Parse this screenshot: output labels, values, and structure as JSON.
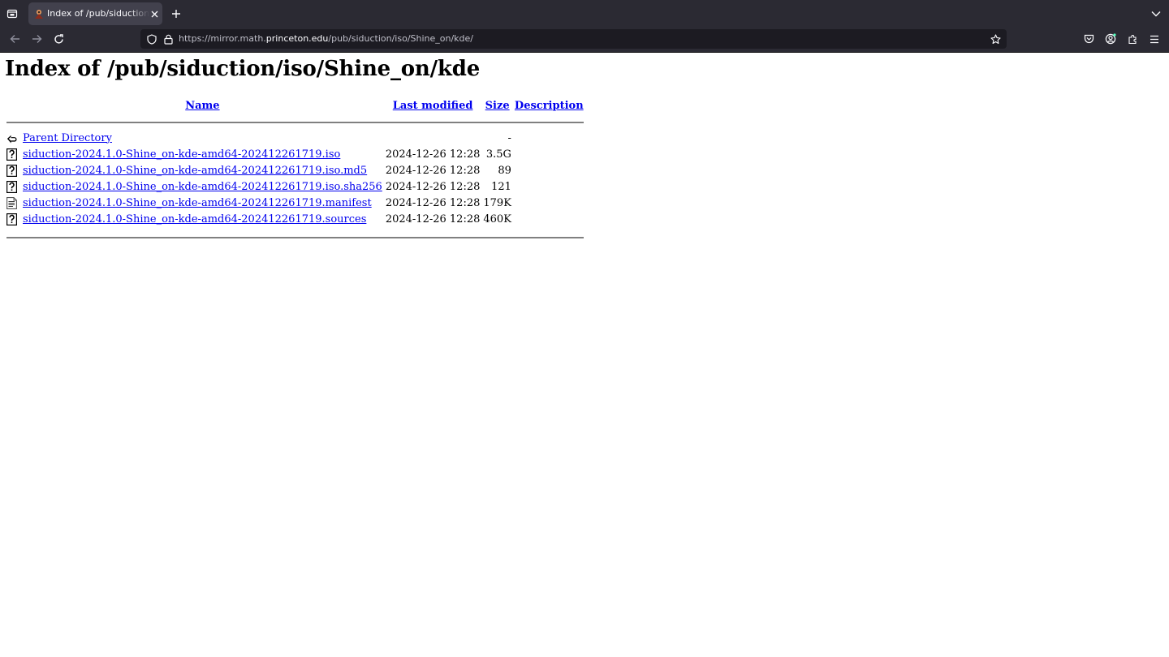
{
  "browser": {
    "tab": {
      "title": "Index of /pub/siduction/iso/Shine_on/kde/"
    },
    "url": {
      "prefix": "https://mirror.math.",
      "host": "princeton.edu",
      "path": "/pub/siduction/iso/Shine_on/kde/"
    }
  },
  "page": {
    "heading": "Index of /pub/siduction/iso/Shine_on/kde",
    "columns": {
      "name": "Name",
      "last_modified": "Last modified",
      "size": "Size",
      "description": "Description"
    },
    "parent": {
      "name": "Parent Directory",
      "size": "-"
    },
    "rows": [
      {
        "name": "siduction-2024.1.0-Shine_on-kde-amd64-202412261719.iso",
        "modified": "2024-12-26 12:28",
        "size": "3.5G",
        "description": "",
        "icon": "unknown-file-icon"
      },
      {
        "name": "siduction-2024.1.0-Shine_on-kde-amd64-202412261719.iso.md5",
        "modified": "2024-12-26 12:28",
        "size": "89",
        "description": "",
        "icon": "unknown-file-icon"
      },
      {
        "name": "siduction-2024.1.0-Shine_on-kde-amd64-202412261719.iso.sha256",
        "modified": "2024-12-26 12:28",
        "size": "121",
        "description": "",
        "icon": "unknown-file-icon"
      },
      {
        "name": "siduction-2024.1.0-Shine_on-kde-amd64-202412261719.manifest",
        "modified": "2024-12-26 12:28",
        "size": "179K",
        "description": "",
        "icon": "text-file-icon"
      },
      {
        "name": "siduction-2024.1.0-Shine_on-kde-amd64-202412261719.sources",
        "modified": "2024-12-26 12:28",
        "size": "460K",
        "description": "",
        "icon": "unknown-file-icon"
      }
    ]
  }
}
